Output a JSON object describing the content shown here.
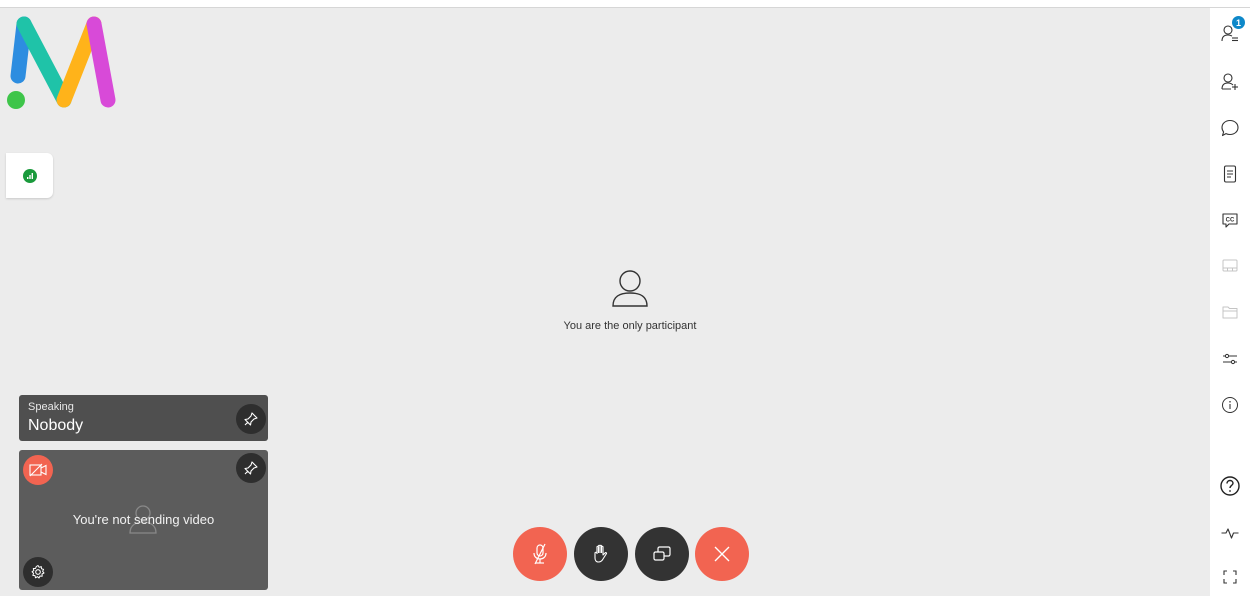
{
  "main": {
    "only_participant_text": "You are the only participant"
  },
  "speaking_card": {
    "label": "Speaking",
    "name": "Nobody"
  },
  "self_view": {
    "status_text": "You're not sending video"
  },
  "participants": {
    "count": "1"
  },
  "colors": {
    "accent_red": "#f26451",
    "control_dark": "#333333",
    "badge_blue": "#0e88c9",
    "network_green": "#1a9a3c"
  },
  "icons": {
    "rail": [
      "participants-icon",
      "invite-icon",
      "chat-icon",
      "notes-icon",
      "captions-icon",
      "whiteboard-icon",
      "files-icon",
      "settings-sliders-icon",
      "info-icon",
      "help-icon",
      "stats-icon",
      "fullscreen-icon"
    ],
    "controls": [
      "mic-muted-icon",
      "raise-hand-icon",
      "share-screen-icon",
      "leave-icon"
    ]
  }
}
